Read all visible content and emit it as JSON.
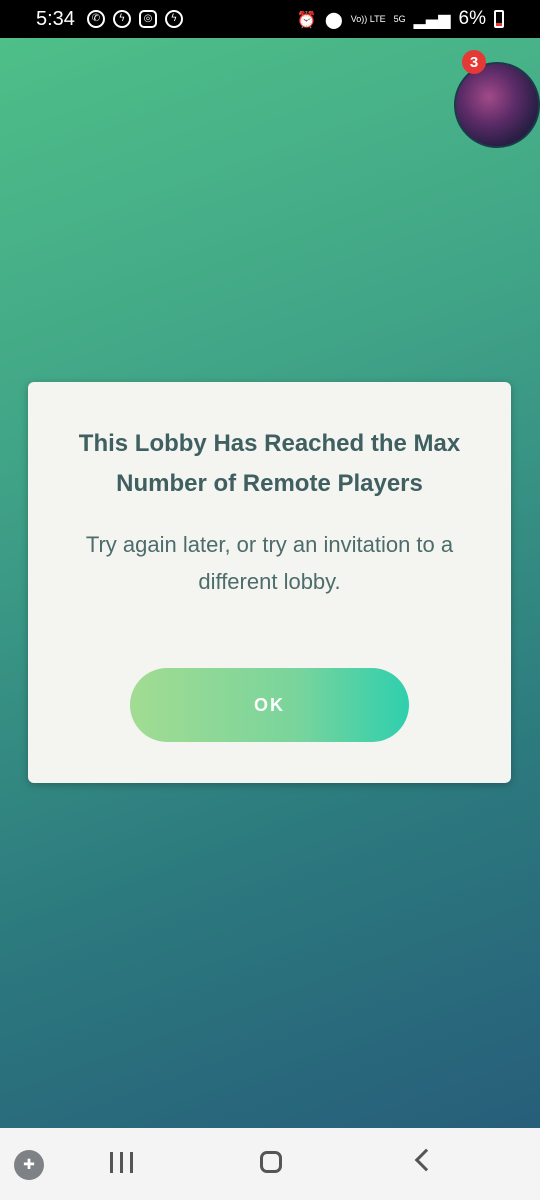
{
  "status_bar": {
    "time": "5:34",
    "left_icons": [
      "whatsapp-icon",
      "messenger-icon",
      "instagram-icon",
      "messenger-icon"
    ],
    "right_icons": [
      "alarm-icon",
      "location-icon",
      "volte-icon",
      "5g-icon",
      "signal-icon"
    ],
    "volte_label": "Vo)) LTE",
    "network_label": "5G",
    "battery_percent": "6%"
  },
  "header": {
    "notification_count": "3"
  },
  "dialog": {
    "title": "This Lobby Has Reached the Max Number of Remote Players",
    "message": "Try again later, or try an invitation to a different lobby.",
    "ok_label": "OK"
  },
  "nav_bar": {
    "items": [
      "game-launcher-icon",
      "recent-apps-icon",
      "home-icon",
      "back-icon"
    ]
  },
  "colors": {
    "background_top": "#4fbf88",
    "background_bottom": "#275e7a",
    "dialog_bg": "#f4f5f0",
    "title_text": "#3f5f60",
    "button_start": "#a2dc92",
    "button_end": "#2fcfae",
    "badge": "#e53935"
  }
}
